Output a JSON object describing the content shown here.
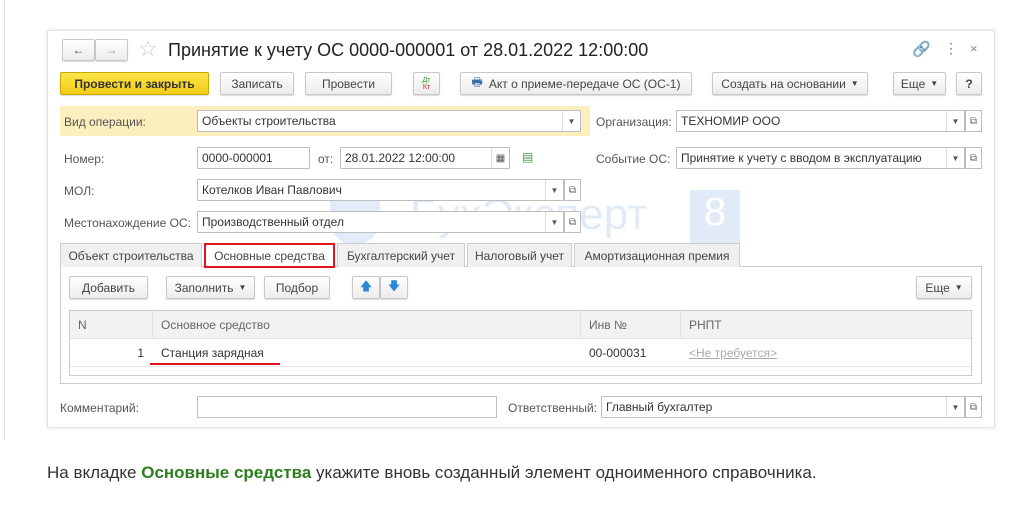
{
  "window": {
    "title": "Принятие к учету ОС 0000-000001 от 28.01.2022 12:00:00"
  },
  "toolbar": {
    "post_close": "Провести и закрыть",
    "save": "Записать",
    "post": "Провести",
    "dtkt_top": "Дт",
    "dtkt_bottom": "Кт",
    "act": "Акт о приеме-передаче ОС (ОС-1)",
    "create_based": "Создать на основании",
    "more": "Еще",
    "help": "?"
  },
  "fields": {
    "operation_label": "Вид операции:",
    "operation_value": "Объекты строительства",
    "org_label": "Организация:",
    "org_value": "ТЕХНОМИР ООО",
    "number_label": "Номер:",
    "number_value": "0000-000001",
    "date_label": "от:",
    "date_value": "28.01.2022 12:00:00",
    "event_label": "Событие ОС:",
    "event_value": "Принятие к учету с вводом в эксплуатацию",
    "mol_label": "МОЛ:",
    "mol_value": "Котелков Иван Павлович",
    "location_label": "Местонахождение ОС:",
    "location_value": "Производственный отдел",
    "comment_label": "Комментарий:",
    "comment_value": "",
    "responsible_label": "Ответственный:",
    "responsible_value": "Главный бухгалтер"
  },
  "tabs": [
    "Объект строительства",
    "Основные средства",
    "Бухгалтерский учет",
    "Налоговый учет",
    "Амортизационная премия"
  ],
  "tab_toolbar": {
    "add": "Добавить",
    "fill": "Заполнить",
    "select": "Подбор",
    "more": "Еще"
  },
  "table": {
    "columns": [
      "N",
      "Основное средство",
      "Инв №",
      "РНПТ"
    ],
    "rows": [
      {
        "n": "1",
        "asset": "Станция зарядная",
        "inv": "00-000031",
        "rnpt": "<Не требуется>"
      }
    ]
  },
  "watermark": "БухЭксперт 8",
  "caption": {
    "before": "На вкладке ",
    "bold": "Основные средства",
    "after": " укажите вновь созданный элемент одноименного справочника."
  },
  "colors": {
    "accent_green": "#2e7d1e",
    "highlight_red": "#e0141e",
    "yellow": "#f2cc14"
  }
}
